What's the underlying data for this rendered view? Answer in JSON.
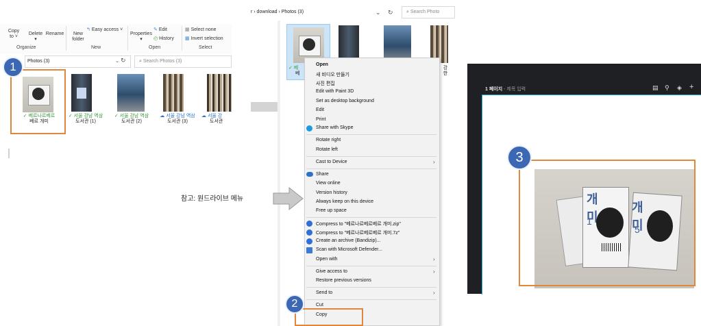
{
  "left_explorer": {
    "ribbon": {
      "copy_to": "Copy to ˅",
      "delete": "Delete",
      "rename": "Rename",
      "new_folder": "New folder",
      "easy_access": "Easy access ˅",
      "properties": "Properties",
      "edit": "Edit",
      "history": "History",
      "select_none": "Select none",
      "invert_selection": "Invert selection",
      "group_organize": "Organize",
      "group_new": "New",
      "group_open": "Open",
      "group_select": "Select"
    },
    "address": "Photos (3)",
    "search_placeholder": "Search Photos (3)",
    "files": [
      {
        "line1": "✓ 베르나르베르",
        "line2": "베르 개미",
        "status": "synced"
      },
      {
        "line1": "✓ 서울 강남 역삼",
        "line2": "도서관 (1)",
        "status": "synced"
      },
      {
        "line1": "✓ 서울 강남 역삼",
        "line2": "도서관 (2)",
        "status": "synced"
      },
      {
        "line1": "☁ 서울 강남 역삼",
        "line2": "도서관 (3)",
        "status": "cloud"
      },
      {
        "line1": "☁ 서울 강",
        "line2": "도서관",
        "status": "cloud"
      }
    ],
    "badge": "1"
  },
  "middle_explorer": {
    "breadcrumb": "r › download › Photos (3)",
    "search_placeholder": "Search Photo",
    "tile_caption_partial": "✓ 베",
    "tile_caption_partial2": "베",
    "right_partial": "강",
    "right_partial2": "한"
  },
  "context_menu": {
    "items": [
      {
        "label": "Open",
        "bold": true
      },
      {
        "label": "새 비디오 만들기"
      },
      {
        "label": "사진 편집"
      },
      {
        "label": "Edit with Paint 3D"
      },
      {
        "label": "Set as desktop background"
      },
      {
        "label": "Edit"
      },
      {
        "label": "Print"
      },
      {
        "label": "Share with Skype",
        "icon": "skype-icon"
      },
      {
        "label": "Rotate right"
      },
      {
        "label": "Rotate left"
      },
      {
        "label": "Cast to Device",
        "submenu": true
      },
      {
        "label": "Share",
        "icon": "onedrive-icon"
      },
      {
        "label": "View online"
      },
      {
        "label": "Version history"
      },
      {
        "label": "Always keep on this device"
      },
      {
        "label": "Free up space"
      },
      {
        "label": "Compress to \"베르나르베르베르 개미.zip\"",
        "icon": "bandizip-icon"
      },
      {
        "label": "Compress to \"베르나르베르베르 개미.7z\"",
        "icon": "bandizip-icon"
      },
      {
        "label": "Create an archive (Bandizip)...",
        "icon": "bandizip-icon"
      },
      {
        "label": "Scan with Microsoft Defender...",
        "icon": "defender-icon"
      },
      {
        "label": "Open with",
        "submenu": true
      },
      {
        "label": "Give access to",
        "submenu": true
      },
      {
        "label": "Restore previous versions"
      },
      {
        "label": "Send to",
        "submenu": true
      },
      {
        "label": "Cut"
      },
      {
        "label": "Copy"
      }
    ],
    "badge": "2"
  },
  "note": {
    "text": "참고: 원드라이브 메뉴"
  },
  "right_panel": {
    "page_title": "1 페이지",
    "title_placeholder": "- 제목 입력",
    "badge": "3",
    "book_text": {
      "a": "개",
      "b": "미",
      "c": "개",
      "d": "미",
      "n1": "1",
      "n2": "5"
    },
    "icons": [
      "note-icon",
      "pin-icon",
      "fill-icon",
      "add-icon"
    ]
  },
  "colors": {
    "highlight": "#e0873a",
    "badge": "#3c67b3",
    "synced": "#3a9a3a",
    "cloud": "#2c72c7",
    "dark_panel": "#1f2023"
  }
}
